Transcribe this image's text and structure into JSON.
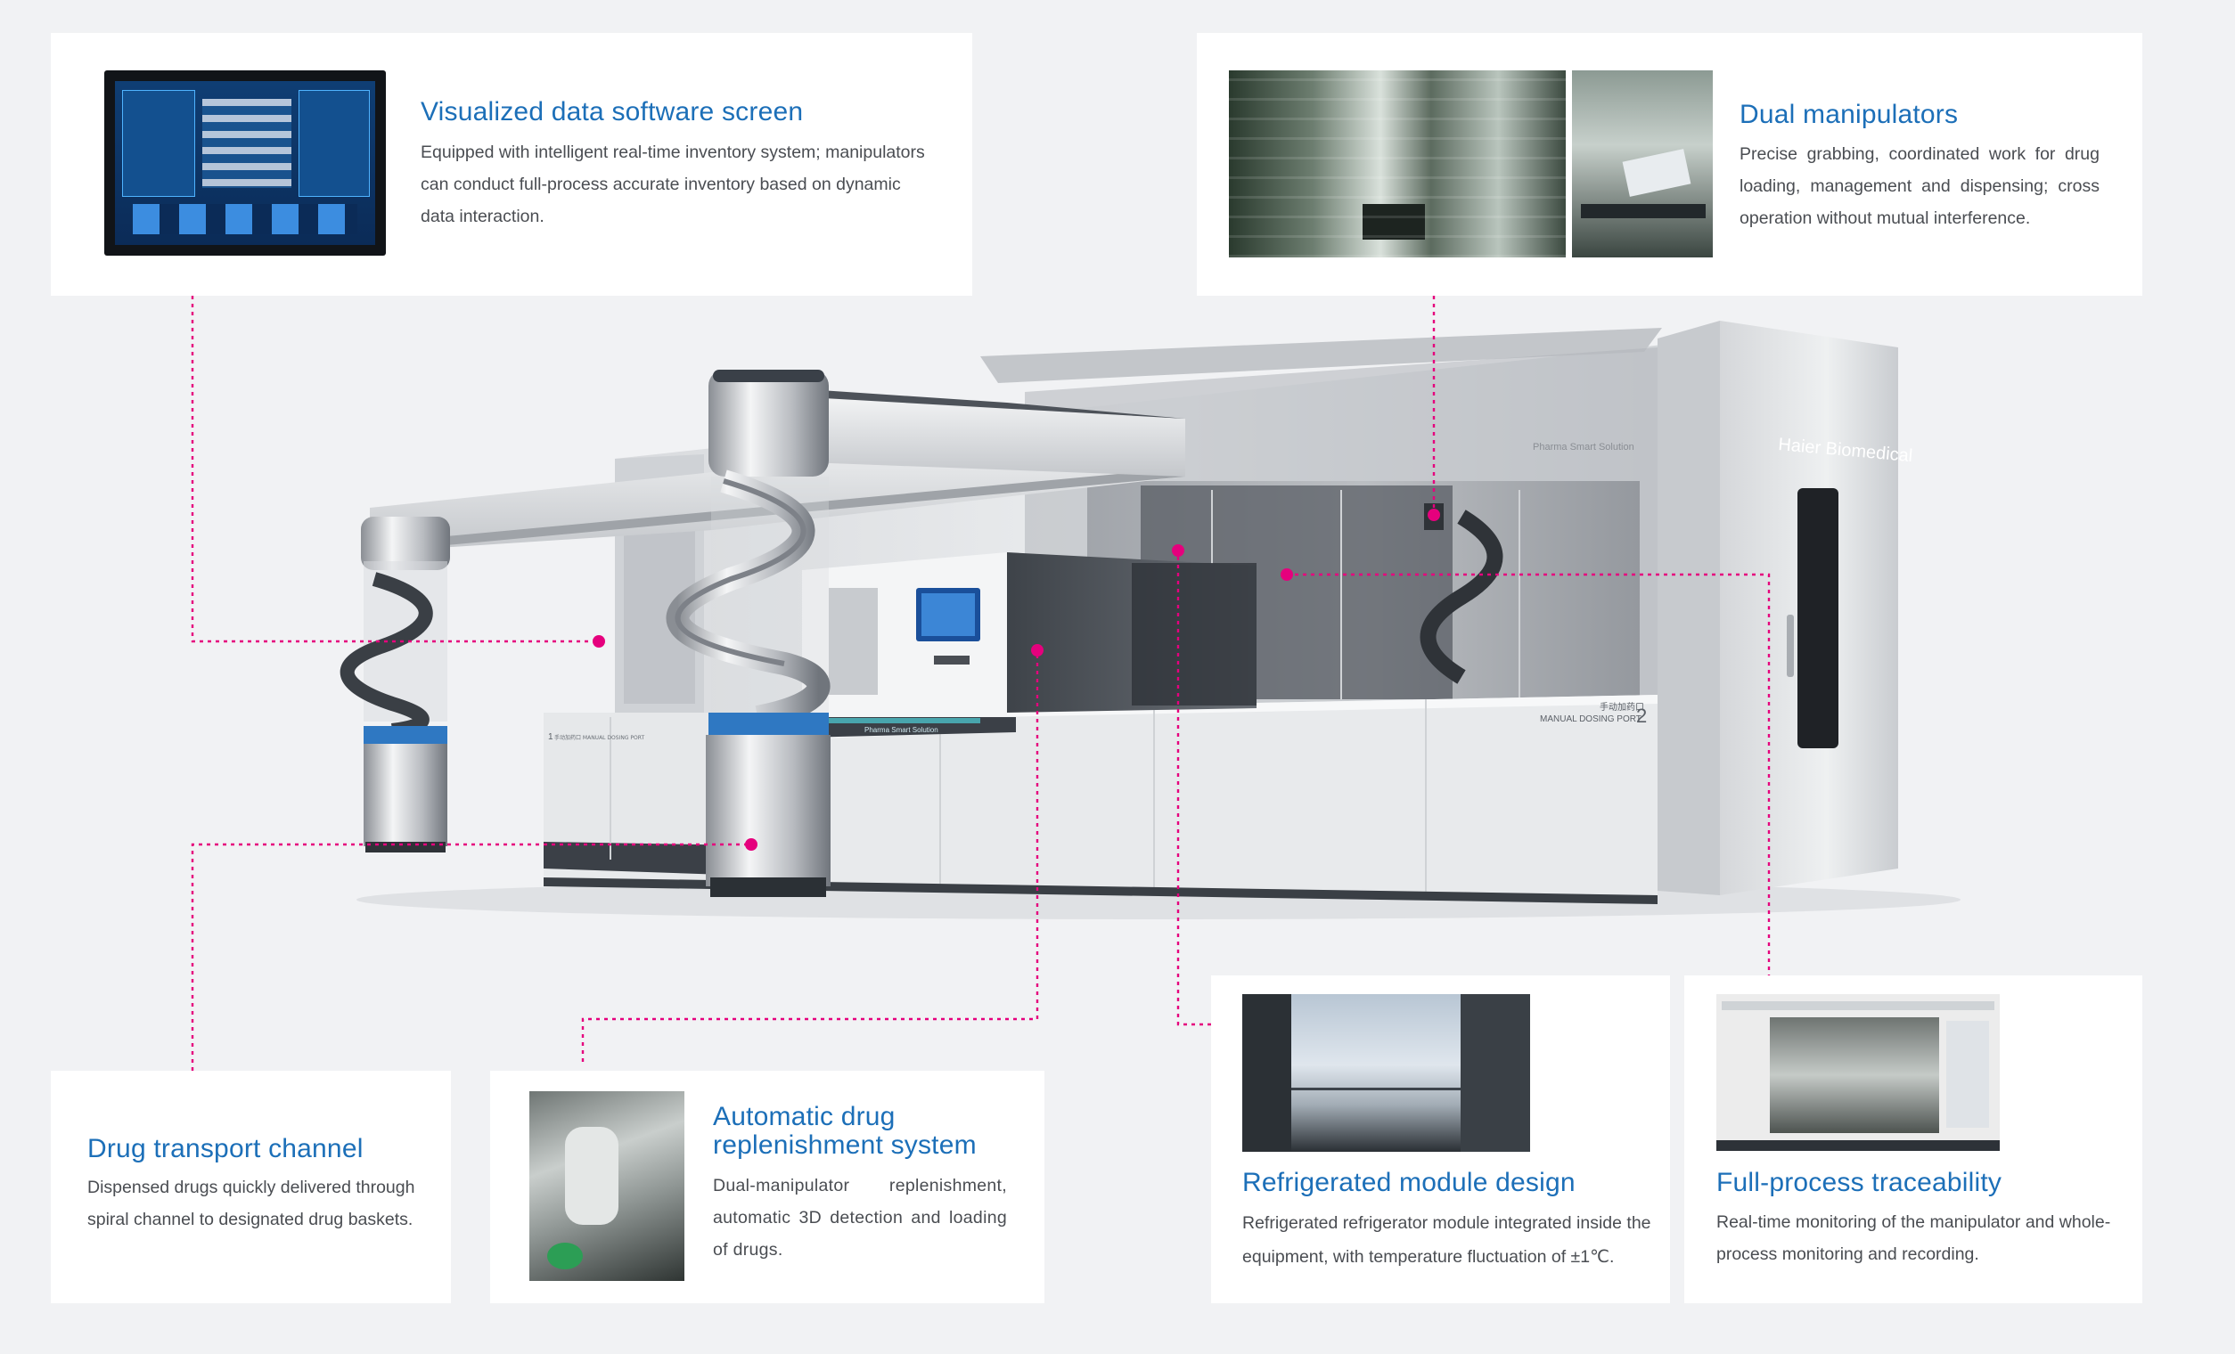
{
  "colors": {
    "page_background": "#f1f2f4",
    "card_background": "#ffffff",
    "title_blue": "#1c6fb8",
    "leader_magenta": "#e5007d",
    "body_text": "#4a4d52"
  },
  "features": {
    "software_screen": {
      "title": "Visualized data software screen",
      "description": "Equipped with intelligent real-time inventory system; manipulators can conduct full-process accurate inventory based on dynamic data interaction."
    },
    "dual_manipulators": {
      "title": "Dual manipulators",
      "description": "Precise grabbing, coordinated work for drug loading, management and dispensing; cross operation without mutual interference."
    },
    "drug_transport": {
      "title": "Drug transport channel",
      "description": "Dispensed drugs quickly delivered through spiral channel to designated drug baskets."
    },
    "replenishment": {
      "title": "Automatic drug replenishment system",
      "description": "Dual-manipulator replenishment, automatic 3D detection and loading of drugs."
    },
    "refrigerated": {
      "title": "Refrigerated module design",
      "description": "Refrigerated refrigerator module integrated inside the equipment, with temperature fluctuation of ±1℃."
    },
    "traceability": {
      "title": "Full-process traceability",
      "description": "Real-time monitoring of the manipulator and whole-process monitoring and recording."
    }
  },
  "machine": {
    "brand": "Haier Biomedical",
    "tagline": "Pharma Smart Solution",
    "port_label": "MANUAL DOSING PORT",
    "port_label_cn": "手动加药口",
    "port_number": "2",
    "port_label_left": "手动加药口 MANUAL DOSING PORT",
    "port_number_left": "1"
  }
}
